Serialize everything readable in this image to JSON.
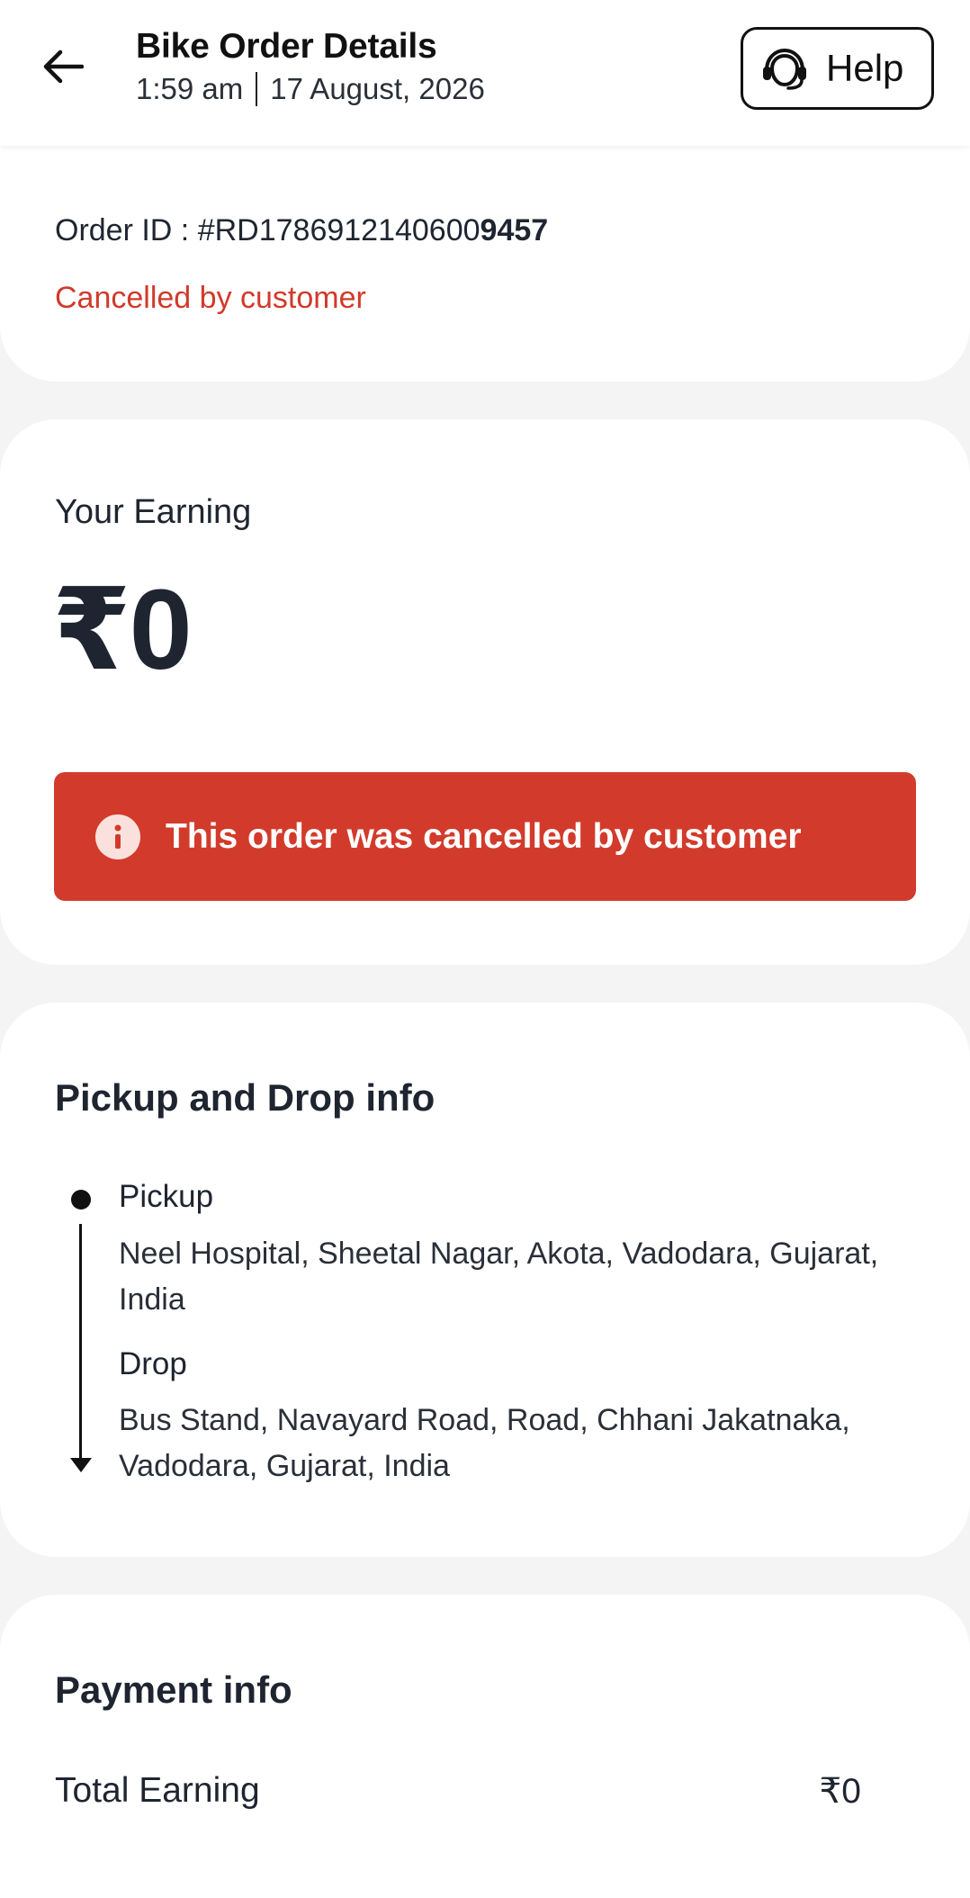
{
  "header": {
    "title": "Bike Order Details",
    "time": "1:59 am",
    "date": "17 August, 2026",
    "help_label": "Help"
  },
  "order": {
    "id_prefix": "Order ID : #RD178691214060",
    "id_bold": "0",
    "id_suffix_bold": "9457",
    "status": "Cancelled by customer"
  },
  "earning": {
    "label": "Your Earning",
    "value": "₹0",
    "banner_text": "This order was cancelled by customer"
  },
  "route": {
    "title": "Pickup and Drop info",
    "pickup_label": "Pickup",
    "pickup_address": "Neel Hospital, Sheetal Nagar, Akota, Vadodara, Gujarat, India",
    "drop_label": "Drop",
    "drop_address": "Bus Stand, Navayard Road, Road, Chhani Jakatnaka, Vadodara, Gujarat, India"
  },
  "payment": {
    "title": "Payment info",
    "rows": [
      {
        "label": "Total Earning",
        "value": "₹0"
      }
    ]
  },
  "colors": {
    "accent_red": "#d23b2b",
    "status_red": "#d13a2b",
    "text_dark": "#1f2530",
    "background": "#f4f4f4"
  },
  "icons": {
    "back": "arrow-left-icon",
    "help": "headset-icon",
    "info": "info-icon"
  }
}
